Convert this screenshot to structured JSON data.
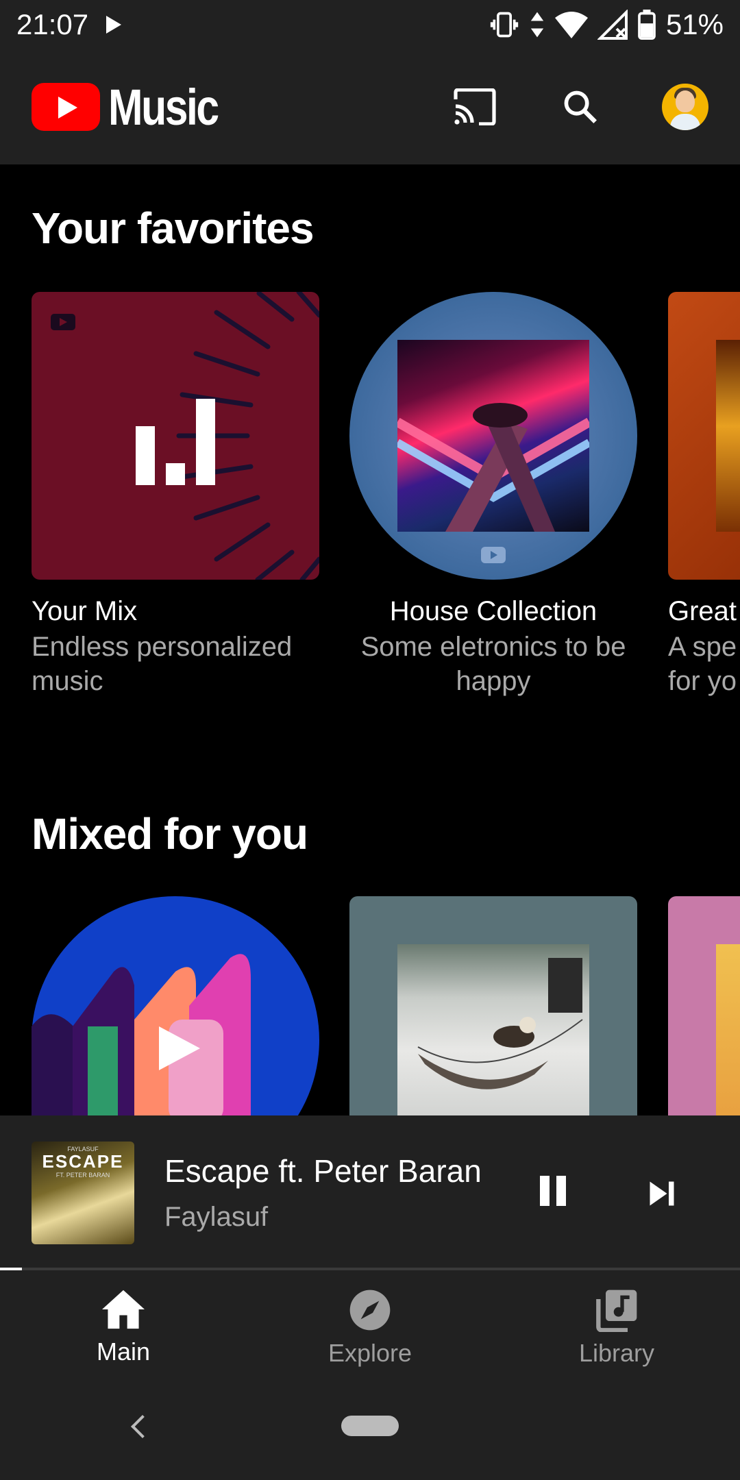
{
  "status_bar": {
    "time": "21:07",
    "battery": "51%",
    "icons": [
      "play-icon",
      "vibrate-icon",
      "data-arrows-icon",
      "wifi-icon",
      "signal-icon",
      "battery-icon"
    ]
  },
  "app_bar": {
    "logo_text": "Music",
    "actions": [
      "cast-icon",
      "search-icon",
      "avatar"
    ]
  },
  "sections": [
    {
      "title": "Your favorites",
      "cards": [
        {
          "title": "Your Mix",
          "subtitle": "Endless personalized music"
        },
        {
          "title": "House Collection",
          "subtitle": "Some eletronics to be happy"
        },
        {
          "title": "Great",
          "subtitle": "A spe for yo"
        }
      ]
    },
    {
      "title": "Mixed for you"
    }
  ],
  "mini_player": {
    "title": "Escape ft. Peter Baran",
    "artist": "Faylasuf",
    "thumb_text": "ESCAPE",
    "thumb_top_text": "FAYLASUF",
    "thumb_sub_text": "FT. PETER BARAN",
    "progress": 0.03
  },
  "bottom_nav": {
    "items": [
      {
        "label": "Main",
        "icon": "home-icon",
        "active": true
      },
      {
        "label": "Explore",
        "icon": "compass-icon",
        "active": false
      },
      {
        "label": "Library",
        "icon": "library-icon",
        "active": false
      }
    ]
  },
  "colors": {
    "brand_red": "#ff0000",
    "surface": "#212121",
    "your_mix_bg": "#6b0f25",
    "secondary_text": "#aaaaaa"
  }
}
